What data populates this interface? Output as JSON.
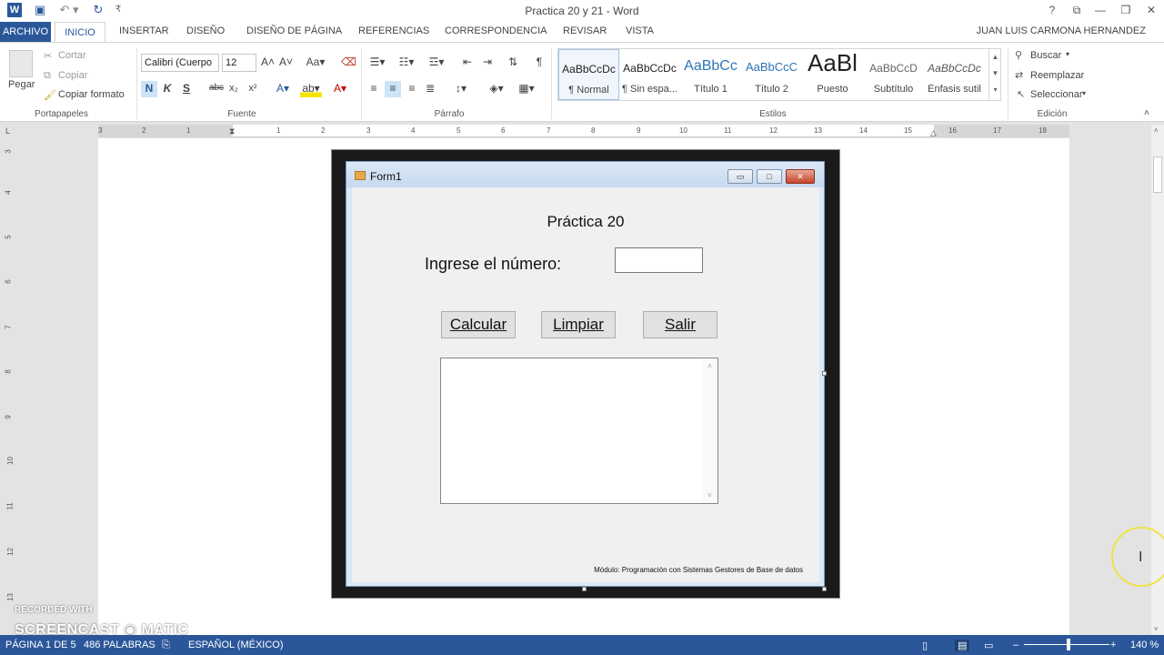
{
  "window": {
    "title": "Practica 20 y 21 - Word",
    "user": "JUAN LUIS CARMONA HERNANDEZ"
  },
  "tabs": [
    "ARCHIVO",
    "INICIO",
    "INSERTAR",
    "DISEÑO",
    "DISEÑO DE PÁGINA",
    "REFERENCIAS",
    "CORRESPONDENCIA",
    "REVISAR",
    "VISTA"
  ],
  "ribbon": {
    "clipboard": {
      "paste": "Pegar",
      "cut": "Cortar",
      "copy": "Copiar",
      "format_painter": "Copiar formato",
      "label": "Portapapeles"
    },
    "font": {
      "name": "Calibri (Cuerpo",
      "size": "12",
      "label": "Fuente",
      "bold": "N",
      "italic": "K",
      "underline": "S",
      "strike": "abc"
    },
    "paragraph": {
      "label": "Párrafo"
    },
    "styles": {
      "label": "Estilos",
      "items": [
        {
          "sample": "AaBbCcDc",
          "name": "¶ Normal"
        },
        {
          "sample": "AaBbCcDc",
          "name": "¶ Sin espa..."
        },
        {
          "sample": "AaBbCc",
          "name": "Título 1"
        },
        {
          "sample": "AaBbCcC",
          "name": "Título 2"
        },
        {
          "sample": "AaBl",
          "name": "Puesto"
        },
        {
          "sample": "AaBbCcD",
          "name": "Subtítulo"
        },
        {
          "sample": "AaBbCcDc",
          "name": "Énfasis sutil"
        }
      ]
    },
    "editing": {
      "find": "Buscar",
      "replace": "Reemplazar",
      "select": "Seleccionar",
      "label": "Edición"
    }
  },
  "ruler": {
    "h": [
      "3",
      "2",
      "1",
      "1",
      "2",
      "3",
      "4",
      "5",
      "6",
      "7",
      "8",
      "9",
      "10",
      "11",
      "12",
      "13",
      "14",
      "15",
      "16",
      "17",
      "18"
    ],
    "v": [
      "3",
      "4",
      "5",
      "6",
      "7",
      "8",
      "9",
      "10",
      "11",
      "12",
      "13"
    ]
  },
  "form": {
    "caption": "Form1",
    "title": "Práctica 20",
    "prompt": "Ingrese el número:",
    "buttons": [
      "Calcular",
      "Limpiar",
      "Salir"
    ],
    "footer": "Módulo: Programación con Sistemas Gestores de Base de datos"
  },
  "watermark": {
    "line1": "RECORDED WITH",
    "line2": "SCREENCAST ◉ MATIC"
  },
  "status": {
    "page": "PÁGINA 1 DE 5",
    "words": "486 PALABRAS",
    "language": "ESPAÑOL (MÉXICO)",
    "zoom": "140 %"
  },
  "colors": {
    "word_blue": "#2b579a"
  }
}
